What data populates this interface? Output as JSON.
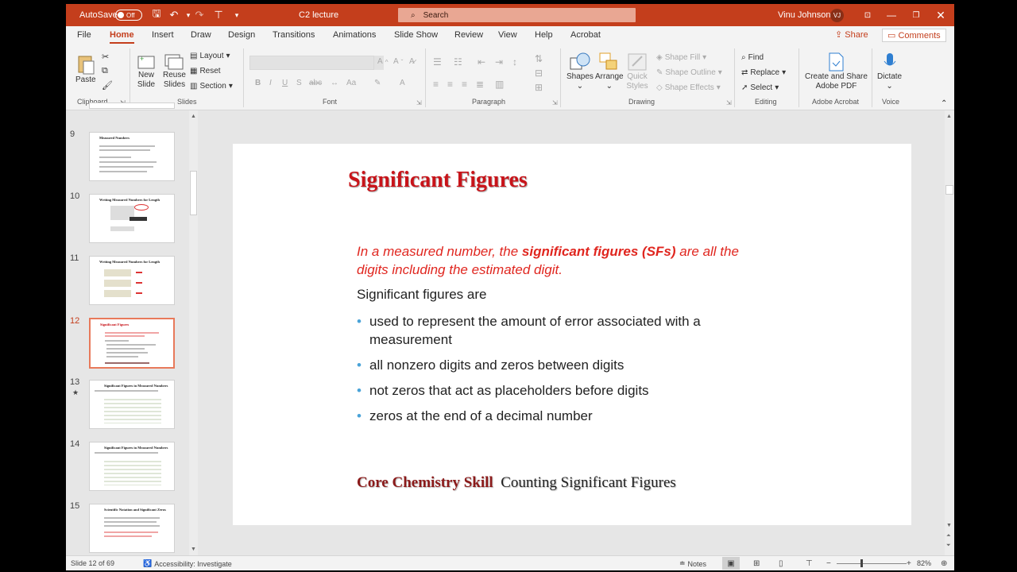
{
  "titlebar": {
    "autosave_label": "AutoSave",
    "autosave_state": "Off",
    "doc_title": "C2 lecture",
    "search_placeholder": "Search",
    "user_name": "Vinu Johnson",
    "user_initials": "VJ"
  },
  "menu": {
    "tabs": [
      "File",
      "Home",
      "Insert",
      "Draw",
      "Design",
      "Transitions",
      "Animations",
      "Slide Show",
      "Review",
      "View",
      "Help",
      "Acrobat"
    ],
    "active_tab": "Home",
    "share": "Share",
    "comments": "Comments"
  },
  "ribbon": {
    "clipboard": {
      "paste": "Paste",
      "label": "Clipboard"
    },
    "slides": {
      "new_slide_1": "New",
      "new_slide_2": "Slide",
      "reuse_1": "Reuse",
      "reuse_2": "Slides",
      "layout": "Layout",
      "reset": "Reset",
      "section": "Section",
      "label": "Slides"
    },
    "font": {
      "bold": "B",
      "italic": "I",
      "underline": "U",
      "shadow": "S",
      "strike": "abc",
      "label": "Font"
    },
    "paragraph": {
      "label": "Paragraph"
    },
    "drawing": {
      "shapes": "Shapes",
      "arrange": "Arrange",
      "quick_1": "Quick",
      "quick_2": "Styles",
      "shape_fill": "Shape Fill",
      "shape_outline": "Shape Outline",
      "shape_effects": "Shape Effects",
      "label": "Drawing"
    },
    "editing": {
      "find": "Find",
      "replace": "Replace",
      "select": "Select",
      "label": "Editing"
    },
    "acrobat": {
      "create_1": "Create and Share",
      "create_2": "Adobe PDF",
      "label": "Adobe Acrobat"
    },
    "voice": {
      "dictate": "Dictate",
      "label": "Voice"
    }
  },
  "thumbnails": [
    {
      "num": "9",
      "title": "Measured Numbers"
    },
    {
      "num": "10",
      "title": "Writing Measured Numbers for Length"
    },
    {
      "num": "11",
      "title": "Writing Measured Numbers for Length"
    },
    {
      "num": "12",
      "title": "Significant Figures"
    },
    {
      "num": "13",
      "title": "Significant Figures in Measured Numbers"
    },
    {
      "num": "14",
      "title": "Significant Figures in Measured Numbers"
    },
    {
      "num": "15",
      "title": "Scientific Notation and Significant Zeros"
    }
  ],
  "slide": {
    "title": "Significant Figures",
    "intro_pre": "In a measured number, the ",
    "intro_bold": "significant figures (SFs)",
    "intro_post": " are all the digits including the estimated digit.",
    "lead": "Significant figures are",
    "bullets": [
      "used to represent the amount of error associated with a measurement",
      "all nonzero digits and zeros between digits",
      "not zeros that act as placeholders before digits",
      "zeros at the end of a decimal number"
    ],
    "core_bold": "Core Chemistry Skill",
    "core_text": "Counting Significant Figures"
  },
  "status": {
    "slide_info": "Slide 12 of 69",
    "accessibility": "Accessibility: Investigate",
    "notes": "Notes",
    "zoom": "82%"
  },
  "colors": {
    "brand": "#c43e1c",
    "title_red": "#c8141a",
    "intro_red": "#e0261f",
    "bullet_blue": "#4aa3d8"
  }
}
